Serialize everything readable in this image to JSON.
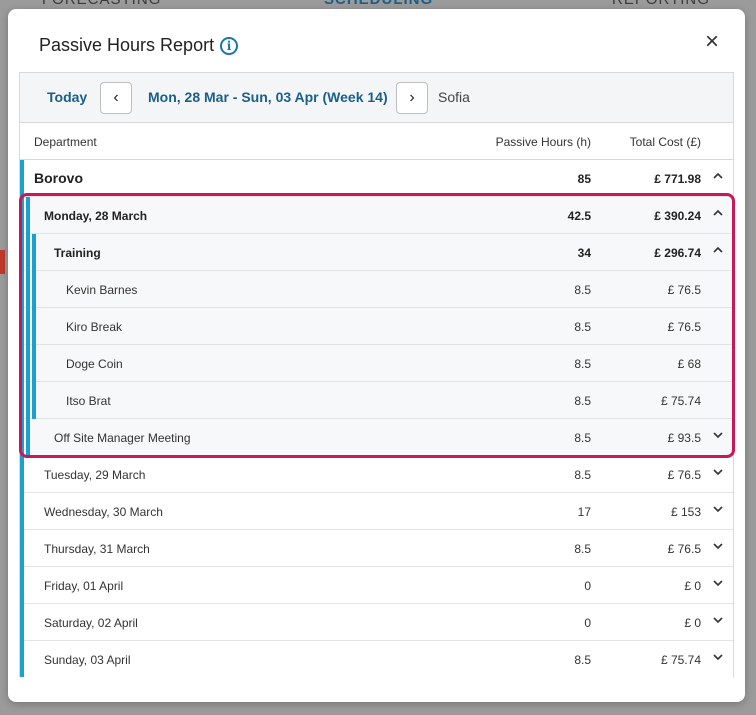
{
  "modal": {
    "title": "Passive Hours Report",
    "info_icon": "info-icon",
    "close_label": "×"
  },
  "toolbar": {
    "today_label": "Today",
    "prev_glyph": "‹",
    "next_glyph": "›",
    "week_range": "Mon, 28 Mar - Sun, 03 Apr (Week 14)",
    "location": "Sofia"
  },
  "table": {
    "columns": {
      "department": "Department",
      "hours": "Passive Hours (h)",
      "cost": "Total Cost (£)"
    },
    "department": {
      "name": "Borovo",
      "hours": "85",
      "cost": "£ 771.98",
      "expanded": true
    },
    "monday": {
      "name": "Monday, 28 March",
      "hours": "42.5",
      "cost": "£ 390.24",
      "expanded": true,
      "training": {
        "name": "Training",
        "hours": "34",
        "cost": "£ 296.74",
        "expanded": true,
        "people": [
          {
            "name": "Kevin Barnes",
            "hours": "8.5",
            "cost": "£ 76.5"
          },
          {
            "name": "Kiro Break",
            "hours": "8.5",
            "cost": "£ 76.5"
          },
          {
            "name": "Doge Coin",
            "hours": "8.5",
            "cost": "£ 68"
          },
          {
            "name": "Itso Brat",
            "hours": "8.5",
            "cost": "£ 75.74"
          }
        ]
      },
      "meeting": {
        "name": "Off Site Manager Meeting",
        "hours": "8.5",
        "cost": "£ 93.5",
        "expanded": false
      }
    },
    "days": [
      {
        "name": "Tuesday, 29 March",
        "hours": "8.5",
        "cost": "£ 76.5"
      },
      {
        "name": "Wednesday, 30 March",
        "hours": "17",
        "cost": "£ 153"
      },
      {
        "name": "Thursday, 31 March",
        "hours": "8.5",
        "cost": "£ 76.5"
      },
      {
        "name": "Friday, 01 April",
        "hours": "0",
        "cost": "£ 0"
      },
      {
        "name": "Saturday, 02 April",
        "hours": "0",
        "cost": "£ 0"
      },
      {
        "name": "Sunday, 03 April",
        "hours": "8.5",
        "cost": "£ 75.74"
      }
    ]
  },
  "colors": {
    "accent": "#1ea0cc",
    "link": "#1a5f8a",
    "highlight": "#c8185a"
  }
}
